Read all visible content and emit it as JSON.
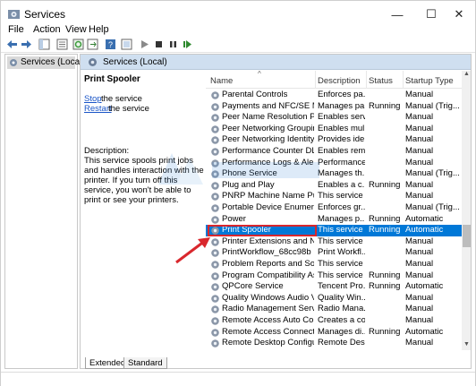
{
  "window": {
    "title": "Services",
    "controls": {
      "minimize": "—",
      "maximize": "☐",
      "close": "✕"
    }
  },
  "menu": [
    "File",
    "Action",
    "View",
    "Help"
  ],
  "tree": {
    "root_label": "Services (Local)"
  },
  "pane": {
    "header": "Services (Local)"
  },
  "description_panel": {
    "service_name": "Print Spooler",
    "stop_link": "Stop",
    "stop_rest": " the service",
    "restart_link": "Restart",
    "restart_rest": " the service",
    "label": "Description:",
    "text": "This service spools print jobs and handles interaction with the printer. If you turn off this service, you won't be able to print or see your printers."
  },
  "table": {
    "columns": [
      "Name",
      "Description",
      "Status",
      "Startup Type"
    ],
    "rows": [
      {
        "name": "Parental Controls",
        "description": "Enforces pa...",
        "status": "",
        "startup": "Manual"
      },
      {
        "name": "Payments and NFC/SE Man...",
        "description": "Manages pa...",
        "status": "Running",
        "startup": "Manual (Trig..."
      },
      {
        "name": "Peer Name Resolution Prot...",
        "description": "Enables serv...",
        "status": "",
        "startup": "Manual"
      },
      {
        "name": "Peer Networking Grouping",
        "description": "Enables mul...",
        "status": "",
        "startup": "Manual"
      },
      {
        "name": "Peer Networking Identity M...",
        "description": "Provides ide...",
        "status": "",
        "startup": "Manual"
      },
      {
        "name": "Performance Counter DLL ...",
        "description": "Enables rem...",
        "status": "",
        "startup": "Manual"
      },
      {
        "name": "Performance Logs & Alerts",
        "description": "Performance...",
        "status": "",
        "startup": "Manual"
      },
      {
        "name": "Phone Service",
        "description": "Manages th...",
        "status": "",
        "startup": "Manual (Trig..."
      },
      {
        "name": "Plug and Play",
        "description": "Enables a c...",
        "status": "Running",
        "startup": "Manual"
      },
      {
        "name": "PNRP Machine Name Publi...",
        "description": "This service ...",
        "status": "",
        "startup": "Manual"
      },
      {
        "name": "Portable Device Enumerator...",
        "description": "Enforces gr...",
        "status": "",
        "startup": "Manual (Trig..."
      },
      {
        "name": "Power",
        "description": "Manages p...",
        "status": "Running",
        "startup": "Automatic"
      },
      {
        "name": "Print Spooler",
        "description": "This service ...",
        "status": "Running",
        "startup": "Automatic"
      },
      {
        "name": "Printer Extensions and Notif...",
        "description": "This service ...",
        "status": "",
        "startup": "Manual"
      },
      {
        "name": "PrintWorkflow_68cc98b",
        "description": "Print Workfl...",
        "status": "",
        "startup": "Manual"
      },
      {
        "name": "Problem Reports and Soluti...",
        "description": "This service ...",
        "status": "",
        "startup": "Manual"
      },
      {
        "name": "Program Compatibility Assi...",
        "description": "This service ...",
        "status": "Running",
        "startup": "Manual"
      },
      {
        "name": "QPCore Service",
        "description": "Tencent Pro...",
        "status": "Running",
        "startup": "Automatic"
      },
      {
        "name": "Quality Windows Audio Vid...",
        "description": "Quality Win...",
        "status": "",
        "startup": "Manual"
      },
      {
        "name": "Radio Management Service",
        "description": "Radio Mana...",
        "status": "",
        "startup": "Manual"
      },
      {
        "name": "Remote Access Auto Conne...",
        "description": "Creates a co...",
        "status": "",
        "startup": "Manual"
      },
      {
        "name": "Remote Access Connection...",
        "description": "Manages di...",
        "status": "Running",
        "startup": "Automatic"
      },
      {
        "name": "Remote Desktop Configurat...",
        "description": "Remote Des...",
        "status": "",
        "startup": "Manual"
      }
    ],
    "selected_index": 12
  },
  "tabs": [
    "Extended",
    "Standard"
  ],
  "colors": {
    "selection": "#0078d7",
    "highlight_box": "#d9272d",
    "header_bg": "#cfdff0"
  }
}
